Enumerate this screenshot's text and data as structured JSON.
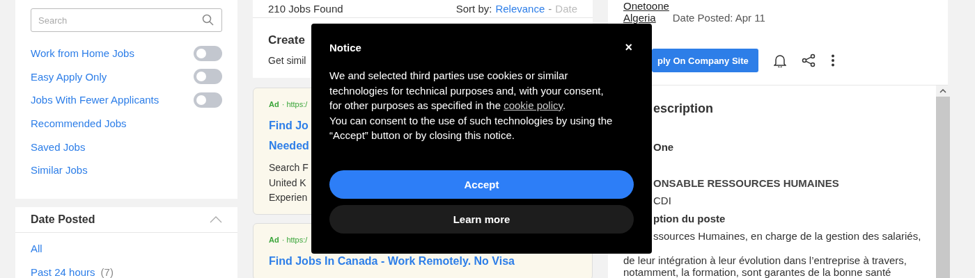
{
  "sidebar": {
    "search": {
      "placeholder": "Search"
    },
    "filters": [
      {
        "label": "Work from Home Jobs",
        "kind": "toggle",
        "on": false
      },
      {
        "label": "Easy Apply Only",
        "kind": "toggle",
        "on": false
      },
      {
        "label": "Jobs With Fewer Applicants",
        "kind": "toggle",
        "on": false
      },
      {
        "label": "Recommended Jobs",
        "kind": "link"
      },
      {
        "label": "Saved Jobs",
        "kind": "link"
      },
      {
        "label": "Similar Jobs",
        "kind": "link"
      }
    ],
    "date_posted": {
      "title": "Date Posted",
      "expanded": true,
      "options": [
        {
          "label": "All"
        },
        {
          "label": "Past 24 hours",
          "count": "(7)"
        }
      ]
    }
  },
  "results": {
    "count": "210 Jobs Found",
    "sort_label": "Sort by:",
    "separator": "-",
    "sort_options": [
      {
        "label": "Relevance",
        "selected": true
      },
      {
        "label": "Date",
        "selected": false
      }
    ],
    "alert": {
      "title": "Create",
      "text": "Get simil"
    },
    "ads": [
      {
        "tag": "Ad",
        "url": "· https:/",
        "title_lines": [
          "Find Jo",
          "Needed"
        ],
        "text_lines": [
          "Search F",
          "United K",
          "Experien"
        ]
      },
      {
        "tag": "Ad",
        "url": "· https:/",
        "title_lines": [
          "Find Jobs In Canada - Work Remotely. No Visa"
        ]
      }
    ]
  },
  "job": {
    "company": "Onetoone",
    "location": "Algeria",
    "date_posted": "Date Posted: Apr 11",
    "apply_button": "ply On Company Site",
    "heading": "escription",
    "lines": [
      {
        "text": "One",
        "kind": "bold",
        "under": true
      },
      {
        "text": "ONSABLE RESSOURCES HUMAINES",
        "kind": "semibold",
        "under": true
      },
      {
        "text": "CDI",
        "kind": "plain",
        "under": true
      },
      {
        "text": "ption du poste",
        "kind": "bold",
        "under": true
      },
      {
        "text": "ssources Humaines, en charge de la gestion des salariés,",
        "kind": "plain",
        "under": true
      },
      {
        "text": "de leur intégration à leur évolution dans l’entreprise à travers,",
        "kind": "plain"
      },
      {
        "text": "notamment, la formation, sont garantes de la bonne santé",
        "kind": "plain"
      }
    ]
  },
  "notice": {
    "title": "Notice",
    "close": "×",
    "text_before": "We and selected third parties use cookies or similar technologies for technical purposes and, with your consent, for other purposes as specified in the ",
    "link": "cookie policy",
    "text_after": ".",
    "text_2": "You can consent to the use of such technologies by using the “Accept” button or by closing this notice.",
    "accept": "Accept",
    "learn_more": "Learn more"
  }
}
